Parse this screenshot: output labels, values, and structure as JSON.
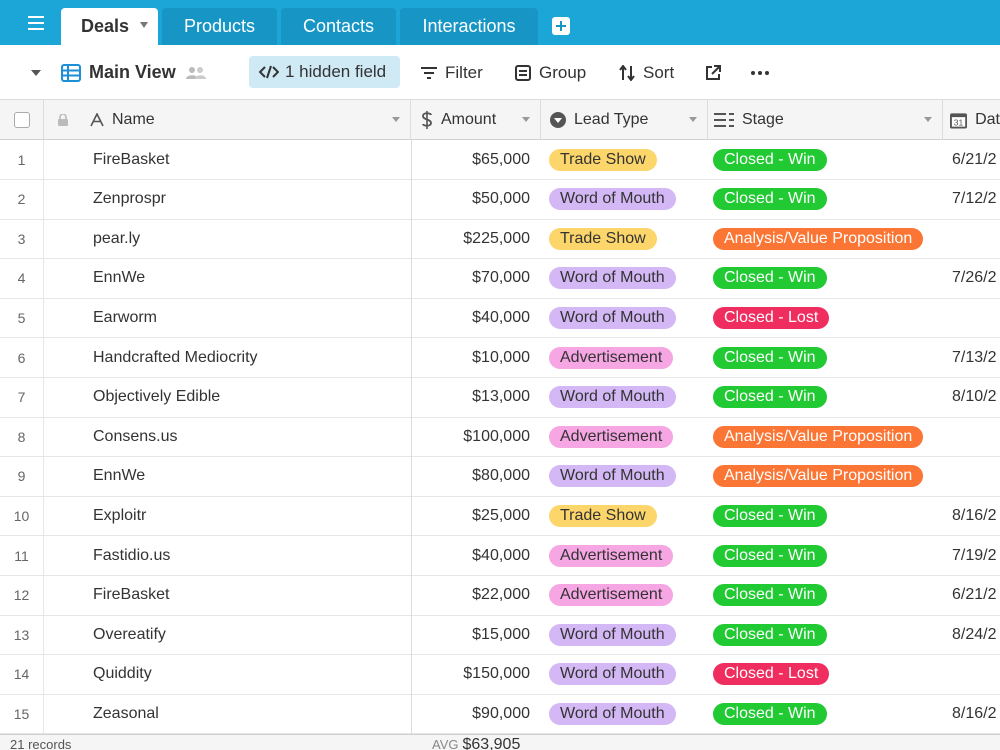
{
  "tabs": [
    {
      "label": "Deals",
      "active": true
    },
    {
      "label": "Products",
      "active": false
    },
    {
      "label": "Contacts",
      "active": false
    },
    {
      "label": "Interactions",
      "active": false
    }
  ],
  "toolbar": {
    "view_name": "Main View",
    "hidden_fields": "1 hidden field",
    "filter": "Filter",
    "group": "Group",
    "sort": "Sort"
  },
  "columns": {
    "name": "Name",
    "amount": "Amount",
    "lead_type": "Lead Type",
    "stage": "Stage",
    "date": "Dat"
  },
  "rows": [
    {
      "num": "1",
      "name": "FireBasket",
      "amount": "$65,000",
      "lead": "Trade Show",
      "stage": "Closed - Win",
      "date": "6/21/2"
    },
    {
      "num": "2",
      "name": "Zenprospr",
      "amount": "$50,000",
      "lead": "Word of Mouth",
      "stage": "Closed - Win",
      "date": "7/12/2"
    },
    {
      "num": "3",
      "name": "pear.ly",
      "amount": "$225,000",
      "lead": "Trade Show",
      "stage": "Analysis/Value Proposition",
      "date": ""
    },
    {
      "num": "4",
      "name": "EnnWe",
      "amount": "$70,000",
      "lead": "Word of Mouth",
      "stage": "Closed - Win",
      "date": "7/26/2"
    },
    {
      "num": "5",
      "name": "Earworm",
      "amount": "$40,000",
      "lead": "Word of Mouth",
      "stage": "Closed - Lost",
      "date": ""
    },
    {
      "num": "6",
      "name": "Handcrafted Mediocrity",
      "amount": "$10,000",
      "lead": "Advertisement",
      "stage": "Closed - Win",
      "date": "7/13/2"
    },
    {
      "num": "7",
      "name": "Objectively Edible",
      "amount": "$13,000",
      "lead": "Word of Mouth",
      "stage": "Closed - Win",
      "date": "8/10/2"
    },
    {
      "num": "8",
      "name": "Consens.us",
      "amount": "$100,000",
      "lead": "Advertisement",
      "stage": "Analysis/Value Proposition",
      "date": ""
    },
    {
      "num": "9",
      "name": "EnnWe",
      "amount": "$80,000",
      "lead": "Word of Mouth",
      "stage": "Analysis/Value Proposition",
      "date": ""
    },
    {
      "num": "10",
      "name": "Exploitr",
      "amount": "$25,000",
      "lead": "Trade Show",
      "stage": "Closed - Win",
      "date": "8/16/2"
    },
    {
      "num": "11",
      "name": "Fastidio.us",
      "amount": "$40,000",
      "lead": "Advertisement",
      "stage": "Closed - Win",
      "date": "7/19/2"
    },
    {
      "num": "12",
      "name": "FireBasket",
      "amount": "$22,000",
      "lead": "Advertisement",
      "stage": "Closed - Win",
      "date": "6/21/2"
    },
    {
      "num": "13",
      "name": "Overeatify",
      "amount": "$15,000",
      "lead": "Word of Mouth",
      "stage": "Closed - Win",
      "date": "8/24/2"
    },
    {
      "num": "14",
      "name": "Quiddity",
      "amount": "$150,000",
      "lead": "Word of Mouth",
      "stage": "Closed - Lost",
      "date": ""
    },
    {
      "num": "15",
      "name": "Zeasonal",
      "amount": "$90,000",
      "lead": "Word of Mouth",
      "stage": "Closed - Win",
      "date": "8/16/2"
    }
  ],
  "footer": {
    "records": "21 records",
    "avg_label": "AVG",
    "avg_value": "$63,905"
  },
  "colors": {
    "tabbar": "#1ba6d7",
    "trade_show": "#fcd66a",
    "word_of_mouth": "#d3b8f5",
    "advertisement": "#f6a6e3",
    "closed_win": "#21c933",
    "closed_lost": "#ef2d5e",
    "analysis": "#fb7534"
  }
}
